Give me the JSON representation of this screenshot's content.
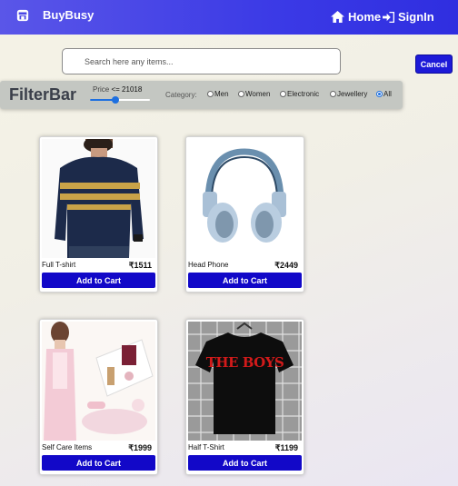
{
  "navbar": {
    "brand_icon": "store-icon",
    "brand": "BuyBusy",
    "home_icon": "home-icon",
    "home": "Home",
    "signin_icon": "signin-icon",
    "signin": "SignIn",
    "color": "#3b3ae6"
  },
  "search": {
    "placeholder": "Search here any items...",
    "value": "",
    "cancel": "Cancel"
  },
  "filter": {
    "title": "FilterBar",
    "price_prefix": "Price",
    "price_op": "<=",
    "price_value": "21018",
    "price_fraction": 0.42,
    "category_label": "Category:",
    "categories": [
      {
        "label": "Men",
        "checked": false
      },
      {
        "label": "Women",
        "checked": false
      },
      {
        "label": "Electronic",
        "checked": false
      },
      {
        "label": "Jewellery",
        "checked": false
      },
      {
        "label": "All",
        "checked": true
      }
    ]
  },
  "products": [
    {
      "name": "Full T-shirt",
      "price": "₹1511",
      "button": "Add to Cart"
    },
    {
      "name": "Head Phone",
      "price": "₹2449",
      "button": "Add to Cart"
    },
    {
      "name": "Self Care Items",
      "price": "₹1999",
      "button": "Add to Cart"
    },
    {
      "name": "Half T-Shirt",
      "price": "₹1199",
      "button": "Add to Cart",
      "print": "THE BOYS"
    }
  ]
}
